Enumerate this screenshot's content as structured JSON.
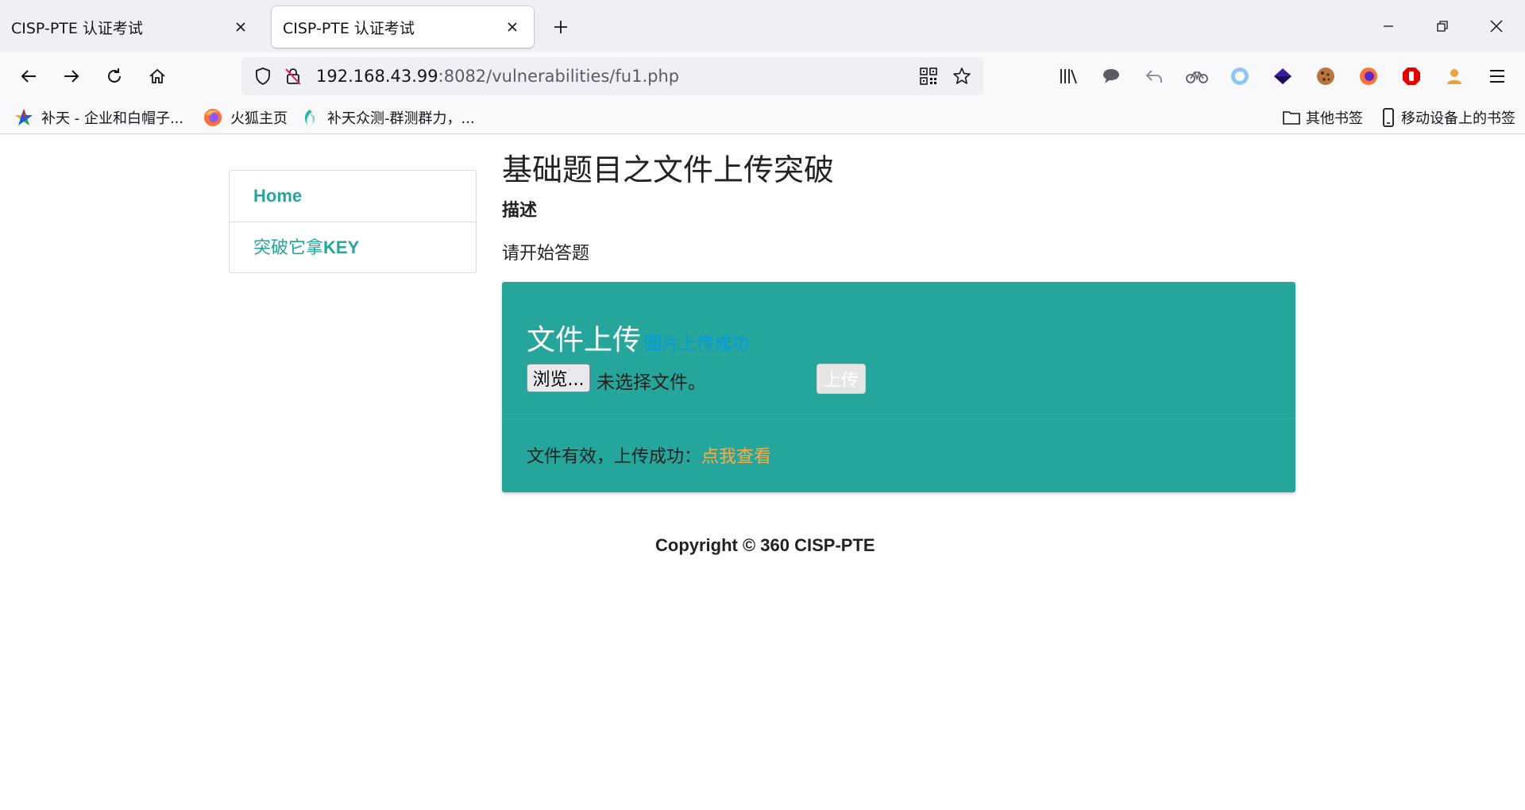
{
  "browser": {
    "tabs": [
      {
        "title": "CISP-PTE 认证考试",
        "active": false
      },
      {
        "title": "CISP-PTE 认证考试",
        "active": true
      }
    ],
    "url": {
      "host": "192.168.43.99",
      "rest": ":8082/vulnerabilities/fu1.php"
    },
    "bookmarks": [
      {
        "label": "补天 - 企业和白帽子...",
        "icon": "butian-star-icon"
      },
      {
        "label": "火狐主页",
        "icon": "firefox-icon"
      },
      {
        "label": "补天众测-群测群力，...",
        "icon": "butian-leaf-icon"
      }
    ],
    "bookmarks_right": [
      {
        "label": "其他书签",
        "icon": "folder-icon"
      },
      {
        "label": "移动设备上的书签",
        "icon": "mobile-icon"
      }
    ],
    "extensions": [
      "library-icon",
      "chat-icon",
      "undo-icon",
      "bike-icon",
      "circle-ext-icon",
      "purple-diamond-icon",
      "cookie-icon",
      "firefox-ext-icon",
      "ublock-icon",
      "user-ext-icon",
      "menu-icon"
    ]
  },
  "sidebar": {
    "items": [
      {
        "label": "Home"
      },
      {
        "label_cn": "突破它拿",
        "label_en": "KEY"
      }
    ]
  },
  "main": {
    "title": "基础题目之文件上传突破",
    "desc_label": "描述",
    "desc_text": "请开始答题",
    "card": {
      "title": "文件上传",
      "message": "图片上传成功",
      "browse_label": "浏览...",
      "no_file_text": "未选择文件。",
      "upload_label": "上传",
      "action_text": "文件有效，上传成功：",
      "action_link": "点我查看"
    },
    "copyright": "Copyright © 360 CISP-PTE"
  },
  "colors": {
    "accent": "#26a69a",
    "link": "#039be5",
    "action_link": "#ffab40"
  }
}
